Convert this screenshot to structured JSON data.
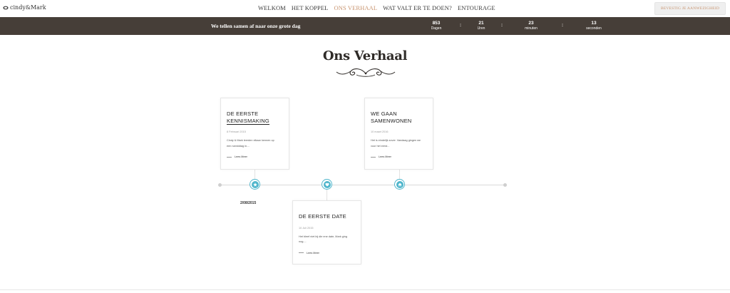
{
  "header": {
    "logo": "cindy&Mark",
    "nav": [
      "WELKOM",
      "HET KOPPEL",
      "ONS VERHAAL",
      "WAT VALT ER TE DOEN?",
      "ENTOURAGE"
    ],
    "active_nav": "ONS VERHAAL",
    "rsvp_label": "BEVESTIG JE AANWEZIGHEID"
  },
  "countdown": {
    "text": "We tellen samen af naar onze grote dag",
    "units": [
      {
        "value": "853",
        "label": "Dagen"
      },
      {
        "value": "21",
        "label": "Uren"
      },
      {
        "value": "23",
        "label": "minuten"
      },
      {
        "value": "13",
        "label": "seconden"
      }
    ],
    "separator": ":"
  },
  "title": "Ons Verhaal",
  "timeline": {
    "date_label": "2/08/2015",
    "stories": [
      {
        "title_line1": "DE EERSTE",
        "title_line2": "KENNISMAKING",
        "date": "8 Februari 2015",
        "text_line1": "Cindy & Mark leerden elkaar kennen op",
        "text_line2": "een namiddag in....",
        "more": "Lees Meer"
      },
      {
        "title_line1": "DE EERSTE DATE",
        "title_line2": "",
        "date": "10 Juli 2015",
        "text_line1": "Het bleef niet bij die ene date, Mark ging",
        "text_line2": "nog....",
        "more": "Lees Meer"
      },
      {
        "title_line1": "WE GAAN",
        "title_line2": "SAMENWONEN",
        "date": "10 maart 2016",
        "text_line1": "Het is eindelijk zover. Vandaag gingen we",
        "text_line2": "voor het eerst...",
        "more": "Lees Meer"
      }
    ],
    "icons": [
      "star-icon",
      "heart-icon",
      "home-icon"
    ]
  },
  "colors": {
    "accent": "#c8946f",
    "countdown_bg": "#463e38",
    "timeline_marker": "#4fb6cc"
  }
}
